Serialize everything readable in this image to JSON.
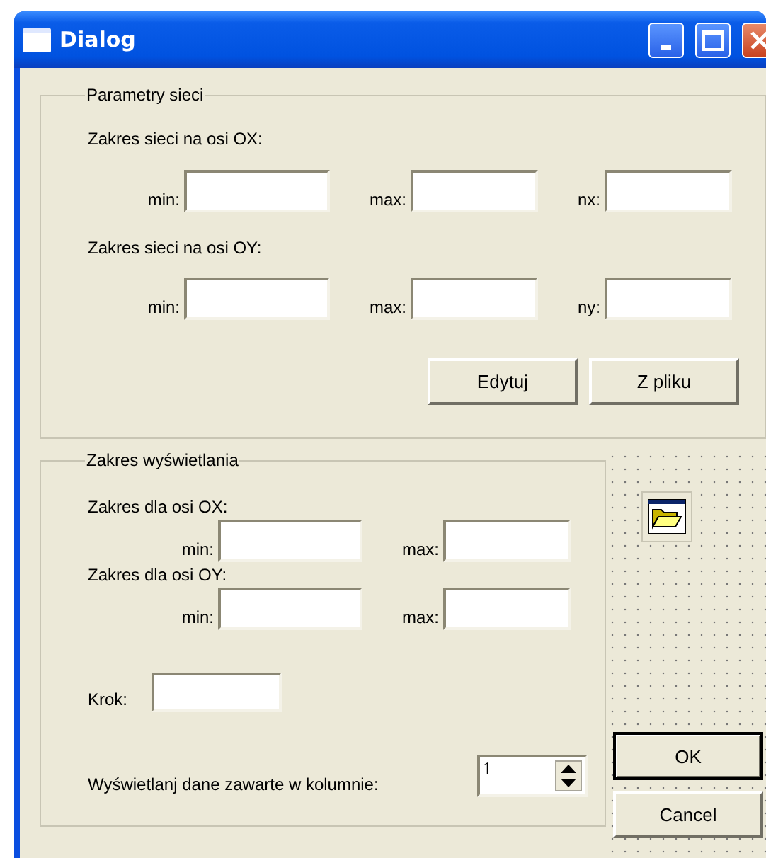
{
  "window": {
    "title": "Dialog"
  },
  "grid_group": {
    "legend": "Parametry sieci",
    "ranges": [
      {
        "heading": "Zakres sieci na osi OX:",
        "fields": [
          {
            "label": "min:"
          },
          {
            "label": "max:"
          },
          {
            "label": "nx:"
          }
        ]
      },
      {
        "heading": "Zakres sieci na osi OY:",
        "fields": [
          {
            "label": "min:"
          },
          {
            "label": "max:"
          },
          {
            "label": "ny:"
          }
        ]
      }
    ],
    "buttons": [
      "Edytuj",
      "Z pliku"
    ]
  },
  "display_group": {
    "legend": "Zakres wyświetlania",
    "ranges": [
      {
        "heading": "Zakres dla osi OX:",
        "fields": [
          {
            "label": "min:"
          },
          {
            "label": "max:"
          }
        ]
      },
      {
        "heading": "Zakres dla osi OY:",
        "fields": [
          {
            "label": "min:"
          },
          {
            "label": "max:"
          }
        ]
      }
    ],
    "step": {
      "label": "Krok:"
    },
    "column": {
      "label": "Wyświetlanj dane zawarte w kolumnie:",
      "value": "1"
    }
  },
  "dialog_buttons": [
    {
      "label": "OK",
      "default": true
    },
    {
      "label": "Cancel",
      "default": false
    }
  ]
}
